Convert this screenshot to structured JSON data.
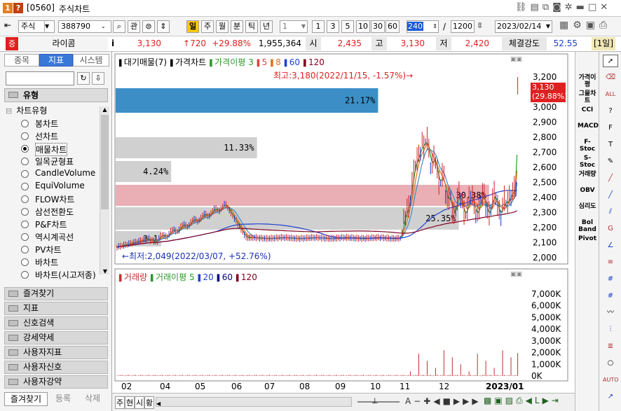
{
  "window": {
    "badge1": "1",
    "badge2": "?",
    "screen_no": "[0560]",
    "title": "주식차트"
  },
  "toolbar": {
    "market": "주식",
    "code": "388790",
    "btn_kwan": "관",
    "periods": [
      "일",
      "주",
      "월",
      "분",
      "틱",
      "년"
    ],
    "active_period": "일",
    "count_select": "1",
    "intervals": [
      "1",
      "3",
      "5",
      "10",
      "30",
      "60"
    ],
    "qty_left": "240",
    "qty_total": "1200",
    "date": "2023/02/14"
  },
  "quote": {
    "updown": "증",
    "name": "라이콤",
    "info": "i",
    "price": "3,130",
    "change": "↑720",
    "rate": "+29.88%",
    "volume": "1,955,364",
    "open_label": "시",
    "open": "2,435",
    "high_label": "고",
    "high": "3,130",
    "low_label": "저",
    "low": "2,420",
    "strength_label": "체결강도",
    "strength": "52.55",
    "term": "[1일]"
  },
  "left": {
    "tabs": [
      "종목",
      "지표",
      "시스템"
    ],
    "active_tab": "지표",
    "section": "유형",
    "tree_root": "차트유형",
    "items": [
      "봉차트",
      "선차트",
      "매물차트",
      "일목균형표",
      "CandleVolume",
      "EquiVolume",
      "FLOW차트",
      "삼선전환도",
      "P&F차트",
      "역시계곡선",
      "PV차트",
      "바차트",
      "바차트(시고저종)"
    ],
    "selected": "매물차트",
    "groups": [
      "즐겨찾기",
      "지표",
      "신호검색",
      "강세약세",
      "사용자지표",
      "사용자신호",
      "사용자강약"
    ],
    "bottom": [
      "즐겨찾기",
      "등록",
      "삭제"
    ]
  },
  "chart": {
    "legend_top": [
      "대기매물(7)",
      "가격차트",
      "가격이평 3",
      "5",
      "8",
      "60",
      "120"
    ],
    "legend_top_colors": [
      "#000",
      "#000",
      "#2a9a2a",
      "#e04040",
      "#e07020",
      "#2040d0",
      "#800020"
    ],
    "max_label": "최고:3,180(2022/11/15, -1.57%)→",
    "min_label": "←최저:2,049(2022/03/07, +52.76%)",
    "current_price": "3,130",
    "current_rate": "(29.88%)",
    "price_axis": [
      "3,200",
      "3,100",
      "3,000",
      "2,900",
      "2,800",
      "2,700",
      "2,600",
      "2,500",
      "2,400",
      "2,300",
      "2,200",
      "2,100",
      "2,000"
    ],
    "volume_profile": [
      {
        "pct": "21.17%",
        "frac": 0.52,
        "color": "#3b8fc6"
      },
      {
        "pct": "11.33%",
        "frac": 0.28,
        "color": "#c8c8c8"
      },
      {
        "pct": "4.24%",
        "frac": 0.11,
        "color": "#c8c8c8"
      },
      {
        "pct": "30.38%",
        "frac": 0.74,
        "color": "#e6a0a8"
      },
      {
        "pct": "25.35%",
        "frac": 0.68,
        "color": "#c8c8c8"
      },
      {
        "pct": "3.1",
        "frac": 0.09,
        "color": "#c8c8c8"
      }
    ],
    "legend_bottom": [
      "거래량",
      "거래이평 5",
      "20",
      "60",
      "120"
    ],
    "legend_bottom_colors": [
      "#c03030",
      "#2a9a2a",
      "#2040d0",
      "#000080",
      "#800020"
    ],
    "volume_axis": [
      "7,000K",
      "6,000K",
      "5,000K",
      "4,000K",
      "3,000K",
      "2,000K",
      "1,000K",
      "0K"
    ],
    "x_axis": [
      "02",
      "04",
      "05",
      "06",
      "07",
      "08",
      "09",
      "10",
      "11",
      "12",
      "2023/01"
    ]
  },
  "right_tools": [
    "가격이평",
    "그물차트",
    "CCI",
    "MACD",
    "F-Stoc",
    "S-Stoc",
    "거래량",
    "OBV",
    "심리도",
    "Bol Band",
    "Pivot"
  ],
  "bottom_bar": {
    "tabs": [
      "주",
      "현",
      "시",
      "황"
    ]
  }
}
